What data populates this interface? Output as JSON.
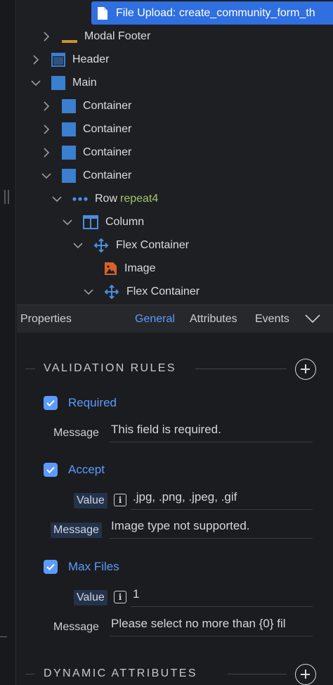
{
  "tree": {
    "selected_item": "File Upload: create_community_form_th",
    "items": [
      {
        "label": "Modal Footer",
        "extra": ""
      },
      {
        "label": "Header",
        "extra": ""
      },
      {
        "label": "Main",
        "extra": ""
      },
      {
        "label": "Container",
        "extra": ""
      },
      {
        "label": "Container",
        "extra": ""
      },
      {
        "label": "Container",
        "extra": ""
      },
      {
        "label": "Container",
        "extra": ""
      },
      {
        "label": "Row",
        "extra": "repeat4"
      },
      {
        "label": "Column",
        "extra": ""
      },
      {
        "label": "Flex Container",
        "extra": ""
      },
      {
        "label": "Image",
        "extra": ""
      },
      {
        "label": "Flex Container",
        "extra": ""
      }
    ]
  },
  "properties": {
    "title": "Properties",
    "tabs": [
      "General",
      "Attributes",
      "Events"
    ],
    "active_tab": "General"
  },
  "validation": {
    "title": "VALIDATION RULES",
    "rules": [
      {
        "label": "Required",
        "checked": true,
        "fields": [
          {
            "label": "Message",
            "value": "This field is required."
          }
        ]
      },
      {
        "label": "Accept",
        "checked": true,
        "fields": [
          {
            "label": "Value",
            "value": ".jpg, .png, .jpeg, .gif"
          },
          {
            "label": "Message",
            "value": "Image type not supported."
          }
        ]
      },
      {
        "label": "Max Files",
        "checked": true,
        "fields": [
          {
            "label": "Value",
            "value": "1"
          },
          {
            "label": "Message",
            "value": "Please select no more than {0} fil"
          }
        ]
      }
    ]
  },
  "dynamic": {
    "title": "DYNAMIC ATTRIBUTES"
  },
  "colors": {
    "accent": "#5b9bff",
    "selection": "#2f6fe0",
    "repeat_tag": "#a6c270",
    "component_blue": "#3a7fd0",
    "image_orange": "#d9622b",
    "footer_bar": "#c8952c"
  },
  "icons": {
    "file": "file-icon",
    "expand": "chevron-right-icon",
    "collapse": "chevron-down-icon",
    "header": "header-block-icon",
    "container": "container-square-icon",
    "row": "row-dots-icon",
    "column": "column-icon",
    "flex": "flex-move-icon",
    "image": "image-icon",
    "add": "plus-circle-icon",
    "info": "info-icon"
  }
}
